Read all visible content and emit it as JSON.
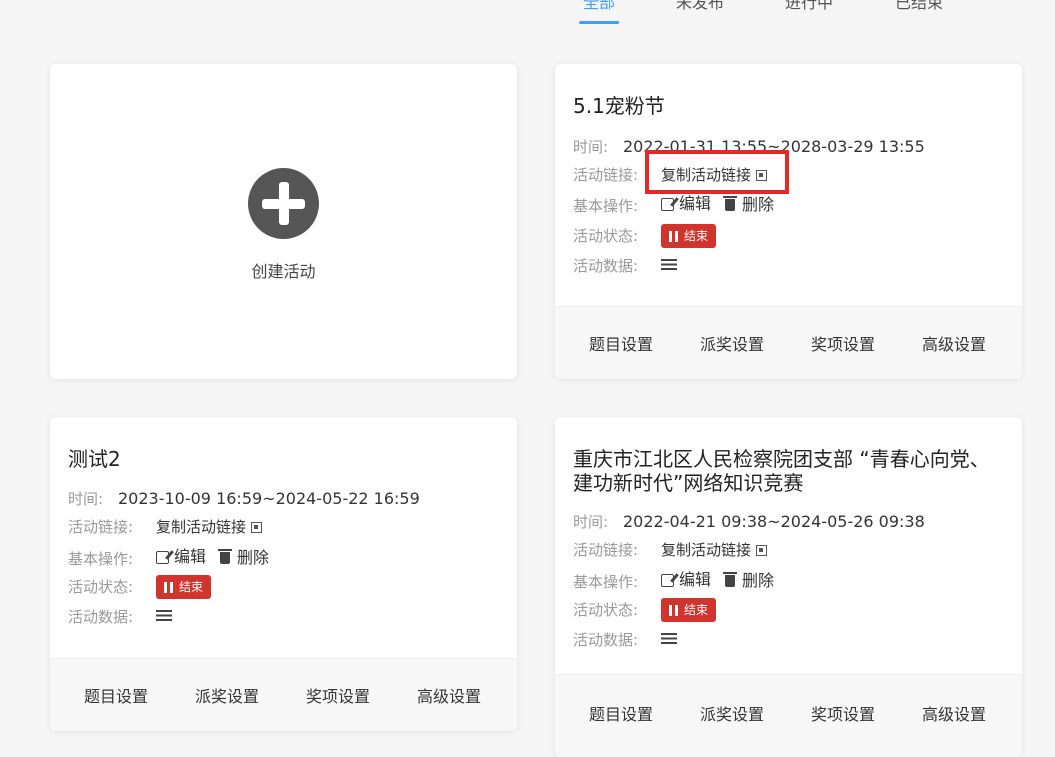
{
  "tabs": [
    "全部",
    "未发布",
    "进行中",
    "已结束"
  ],
  "create": {
    "label": "创建活动"
  },
  "labels": {
    "time": "时间:",
    "link": "活动链接:",
    "ops": "基本操作:",
    "status": "活动状态:",
    "data": "活动数据:",
    "copy_link": "复制活动链接",
    "edit": "编辑",
    "delete": "删除",
    "ended": "结束"
  },
  "footer_buttons": [
    "题目设置",
    "派奖设置",
    "奖项设置",
    "高级设置"
  ],
  "activities": [
    {
      "title": "5.1宠粉节",
      "time": "2022-01-31 13:55~2028-03-29 13:55"
    },
    {
      "title": "测试2",
      "time": "2023-10-09 16:59~2024-05-22 16:59"
    },
    {
      "title": "重庆市江北区人民检察院团支部 “青春心向党、建功新时代”网络知识竞赛",
      "time": "2022-04-21 09:38~2024-05-26 09:38"
    }
  ],
  "colors": {
    "accent": "#409eff",
    "ended_badge": "#d0342c",
    "highlight": "#e8272b"
  }
}
